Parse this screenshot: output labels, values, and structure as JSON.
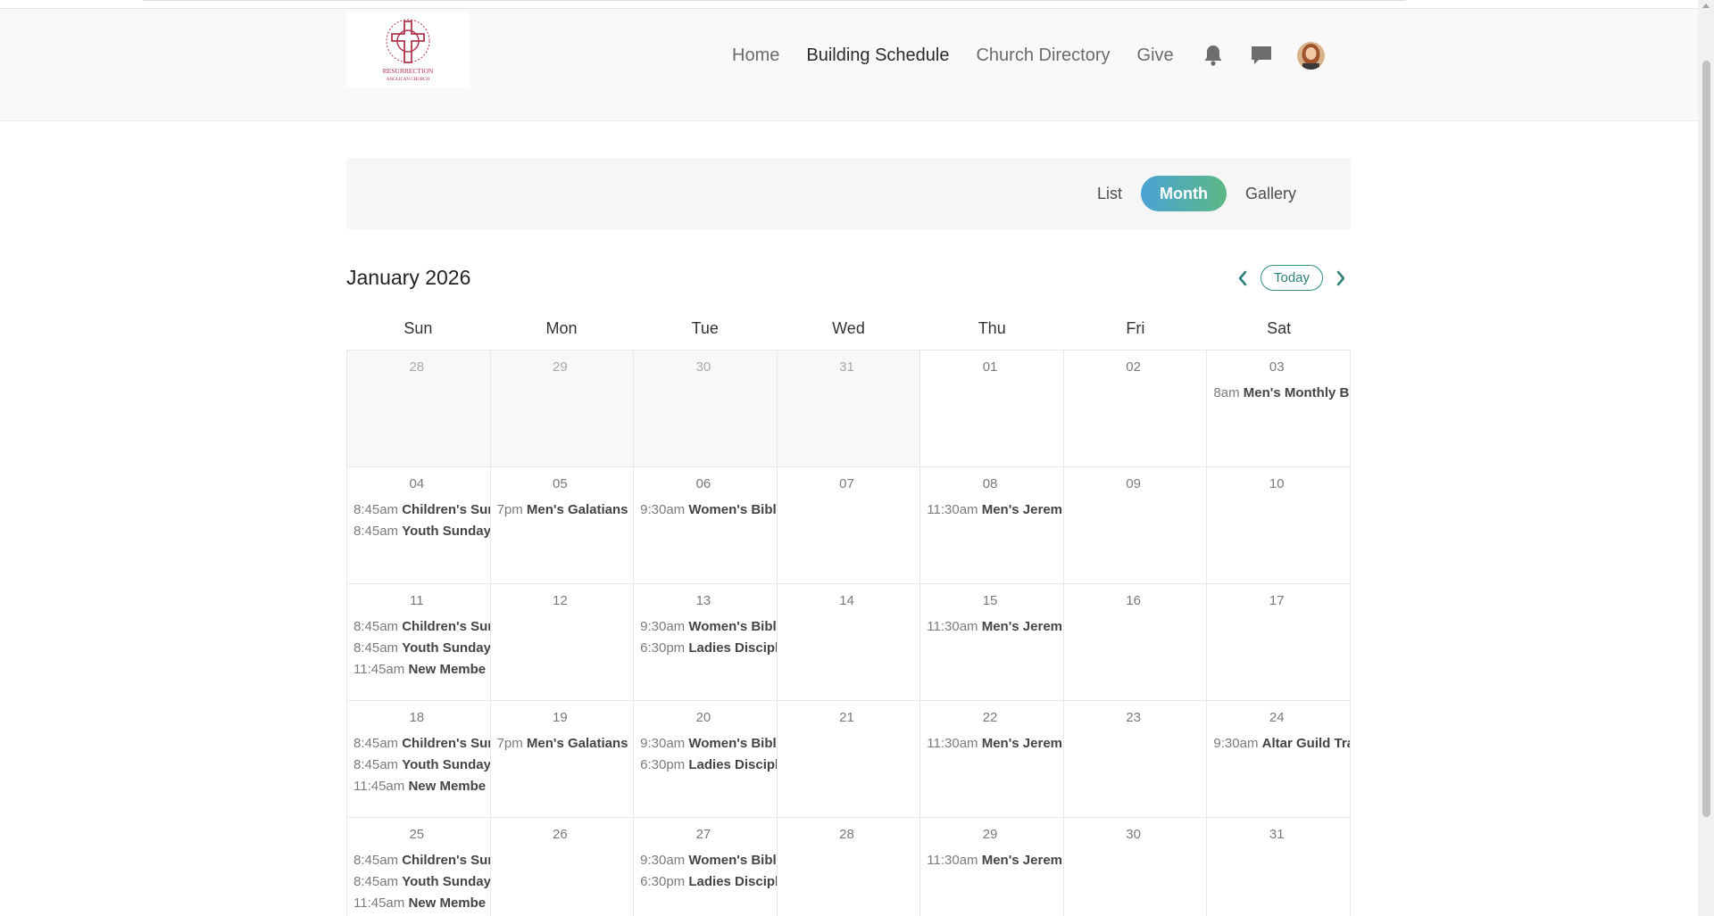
{
  "header": {
    "logo_alt": "Resurrection Anglican Church",
    "logo_text_line1": "RESURRECTION",
    "logo_text_line2": "ANGLICAN CHURCH",
    "nav": [
      {
        "label": "Home",
        "active": false
      },
      {
        "label": "Building Schedule",
        "active": true
      },
      {
        "label": "Church Directory",
        "active": false
      },
      {
        "label": "Give",
        "active": false
      }
    ],
    "icons": [
      "bell-icon",
      "chat-icon"
    ],
    "avatar": "user-avatar"
  },
  "views": {
    "options": [
      "List",
      "Month",
      "Gallery"
    ],
    "active": "Month"
  },
  "calendar": {
    "title": "January 2026",
    "today_label": "Today",
    "weekdays": [
      "Sun",
      "Mon",
      "Tue",
      "Wed",
      "Thu",
      "Fri",
      "Sat"
    ],
    "days": [
      {
        "num": "28",
        "other": true,
        "events": []
      },
      {
        "num": "29",
        "other": true,
        "events": []
      },
      {
        "num": "30",
        "other": true,
        "events": []
      },
      {
        "num": "31",
        "other": true,
        "events": []
      },
      {
        "num": "01",
        "other": false,
        "events": []
      },
      {
        "num": "02",
        "other": false,
        "events": []
      },
      {
        "num": "03",
        "other": false,
        "events": [
          {
            "time": "8am",
            "name": "Men's Monthly B"
          }
        ]
      },
      {
        "num": "04",
        "other": false,
        "events": [
          {
            "time": "8:45am",
            "name": "Children's Sur"
          },
          {
            "time": "8:45am",
            "name": "Youth Sunday"
          }
        ]
      },
      {
        "num": "05",
        "other": false,
        "events": [
          {
            "time": "7pm",
            "name": "Men's Galatians"
          }
        ]
      },
      {
        "num": "06",
        "other": false,
        "events": [
          {
            "time": "9:30am",
            "name": "Women's Bibl"
          }
        ]
      },
      {
        "num": "07",
        "other": false,
        "events": []
      },
      {
        "num": "08",
        "other": false,
        "events": [
          {
            "time": "11:30am",
            "name": "Men's Jerem"
          }
        ]
      },
      {
        "num": "09",
        "other": false,
        "events": []
      },
      {
        "num": "10",
        "other": false,
        "events": []
      },
      {
        "num": "11",
        "other": false,
        "events": [
          {
            "time": "8:45am",
            "name": "Children's Sur"
          },
          {
            "time": "8:45am",
            "name": "Youth Sunday"
          },
          {
            "time": "11:45am",
            "name": "New Membe"
          }
        ]
      },
      {
        "num": "12",
        "other": false,
        "events": []
      },
      {
        "num": "13",
        "other": false,
        "events": [
          {
            "time": "9:30am",
            "name": "Women's Bibl"
          },
          {
            "time": "6:30pm",
            "name": "Ladies Discipl"
          }
        ]
      },
      {
        "num": "14",
        "other": false,
        "events": []
      },
      {
        "num": "15",
        "other": false,
        "events": [
          {
            "time": "11:30am",
            "name": "Men's Jerem"
          }
        ]
      },
      {
        "num": "16",
        "other": false,
        "events": []
      },
      {
        "num": "17",
        "other": false,
        "events": []
      },
      {
        "num": "18",
        "other": false,
        "events": [
          {
            "time": "8:45am",
            "name": "Children's Sur"
          },
          {
            "time": "8:45am",
            "name": "Youth Sunday"
          },
          {
            "time": "11:45am",
            "name": "New Membe"
          }
        ]
      },
      {
        "num": "19",
        "other": false,
        "events": [
          {
            "time": "7pm",
            "name": "Men's Galatians"
          }
        ]
      },
      {
        "num": "20",
        "other": false,
        "events": [
          {
            "time": "9:30am",
            "name": "Women's Bibl"
          },
          {
            "time": "6:30pm",
            "name": "Ladies Discipl"
          }
        ]
      },
      {
        "num": "21",
        "other": false,
        "events": []
      },
      {
        "num": "22",
        "other": false,
        "events": [
          {
            "time": "11:30am",
            "name": "Men's Jerem"
          }
        ]
      },
      {
        "num": "23",
        "other": false,
        "events": []
      },
      {
        "num": "24",
        "other": false,
        "events": [
          {
            "time": "9:30am",
            "name": "Altar Guild Tra"
          }
        ]
      },
      {
        "num": "25",
        "other": false,
        "events": [
          {
            "time": "8:45am",
            "name": "Children's Sur"
          },
          {
            "time": "8:45am",
            "name": "Youth Sunday"
          },
          {
            "time": "11:45am",
            "name": "New Membe"
          }
        ]
      },
      {
        "num": "26",
        "other": false,
        "events": []
      },
      {
        "num": "27",
        "other": false,
        "events": [
          {
            "time": "9:30am",
            "name": "Women's Bibl"
          },
          {
            "time": "6:30pm",
            "name": "Ladies Discipl"
          }
        ]
      },
      {
        "num": "28",
        "other": false,
        "events": []
      },
      {
        "num": "29",
        "other": false,
        "events": [
          {
            "time": "11:30am",
            "name": "Men's Jerem"
          }
        ]
      },
      {
        "num": "30",
        "other": false,
        "events": []
      },
      {
        "num": "31",
        "other": false,
        "events": []
      }
    ]
  },
  "colors": {
    "accent_gradient_start": "#4aa3d6",
    "accent_gradient_end": "#5cb784",
    "today_border": "#2f8f83",
    "logo_red": "#b0344a"
  }
}
